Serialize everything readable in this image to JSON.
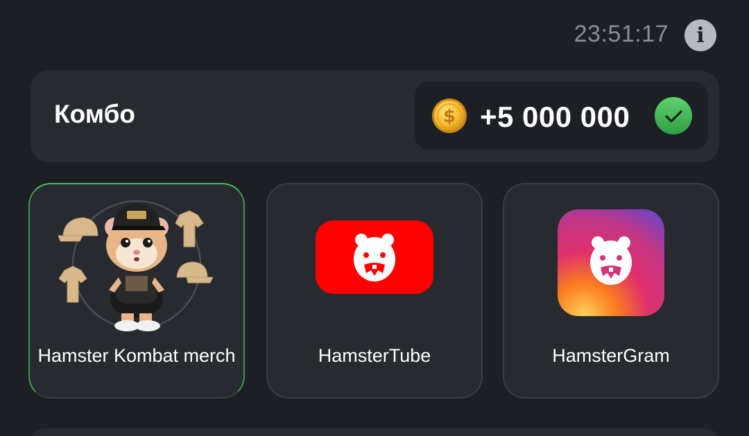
{
  "header": {
    "time": "23:51:17",
    "info_icon": "info-icon"
  },
  "combo": {
    "title": "Комбо",
    "reward": "+5 000 000",
    "coin_icon": "coin-icon",
    "status_icon": "check-icon",
    "status": "completed"
  },
  "cards": [
    {
      "label": "Hamster Kombat merch",
      "icon": "hamster-merch-image",
      "completed": true
    },
    {
      "label": "HamsterTube",
      "icon": "hamstertube-logo-icon",
      "completed": false
    },
    {
      "label": "HamsterGram",
      "icon": "hamstergram-logo-icon",
      "completed": false
    }
  ],
  "colors": {
    "background": "#1c1f24",
    "panel": "#272a2f",
    "accent_green": "#4cbd5e",
    "coin_gold": "#f6b92b",
    "tube_red": "#ff0000"
  }
}
